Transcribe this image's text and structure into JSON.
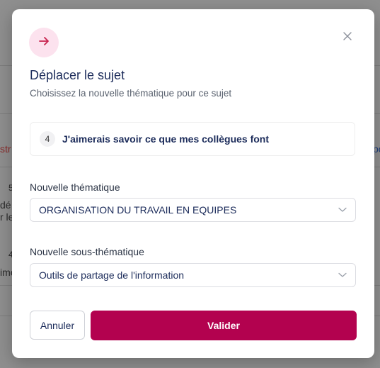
{
  "background": {
    "fragments": [
      "str",
      "dé",
      "r le",
      "ime",
      "5",
      "4",
      "po"
    ]
  },
  "modal": {
    "header_icon": "arrow-right-icon",
    "close_icon": "close-icon",
    "title": "Déplacer le sujet",
    "subtitle": "Choisissez la nouvelle thématique pour ce sujet",
    "topic": {
      "number": "4",
      "text": "J'aimerais savoir ce que mes collègues font"
    },
    "theme_field": {
      "label": "Nouvelle thématique",
      "value": "ORGANISATION DU TRAVAIL EN EQUIPES"
    },
    "subtheme_field": {
      "label": "Nouvelle sous-thématique",
      "value": "Outils de partage de l'information"
    },
    "cancel_label": "Annuler",
    "submit_label": "Valider"
  },
  "colors": {
    "accent": "#b3024f",
    "icon_bg": "#fce2ee",
    "icon_arrow": "#c8234e",
    "text_dark": "#1b2b5a"
  }
}
